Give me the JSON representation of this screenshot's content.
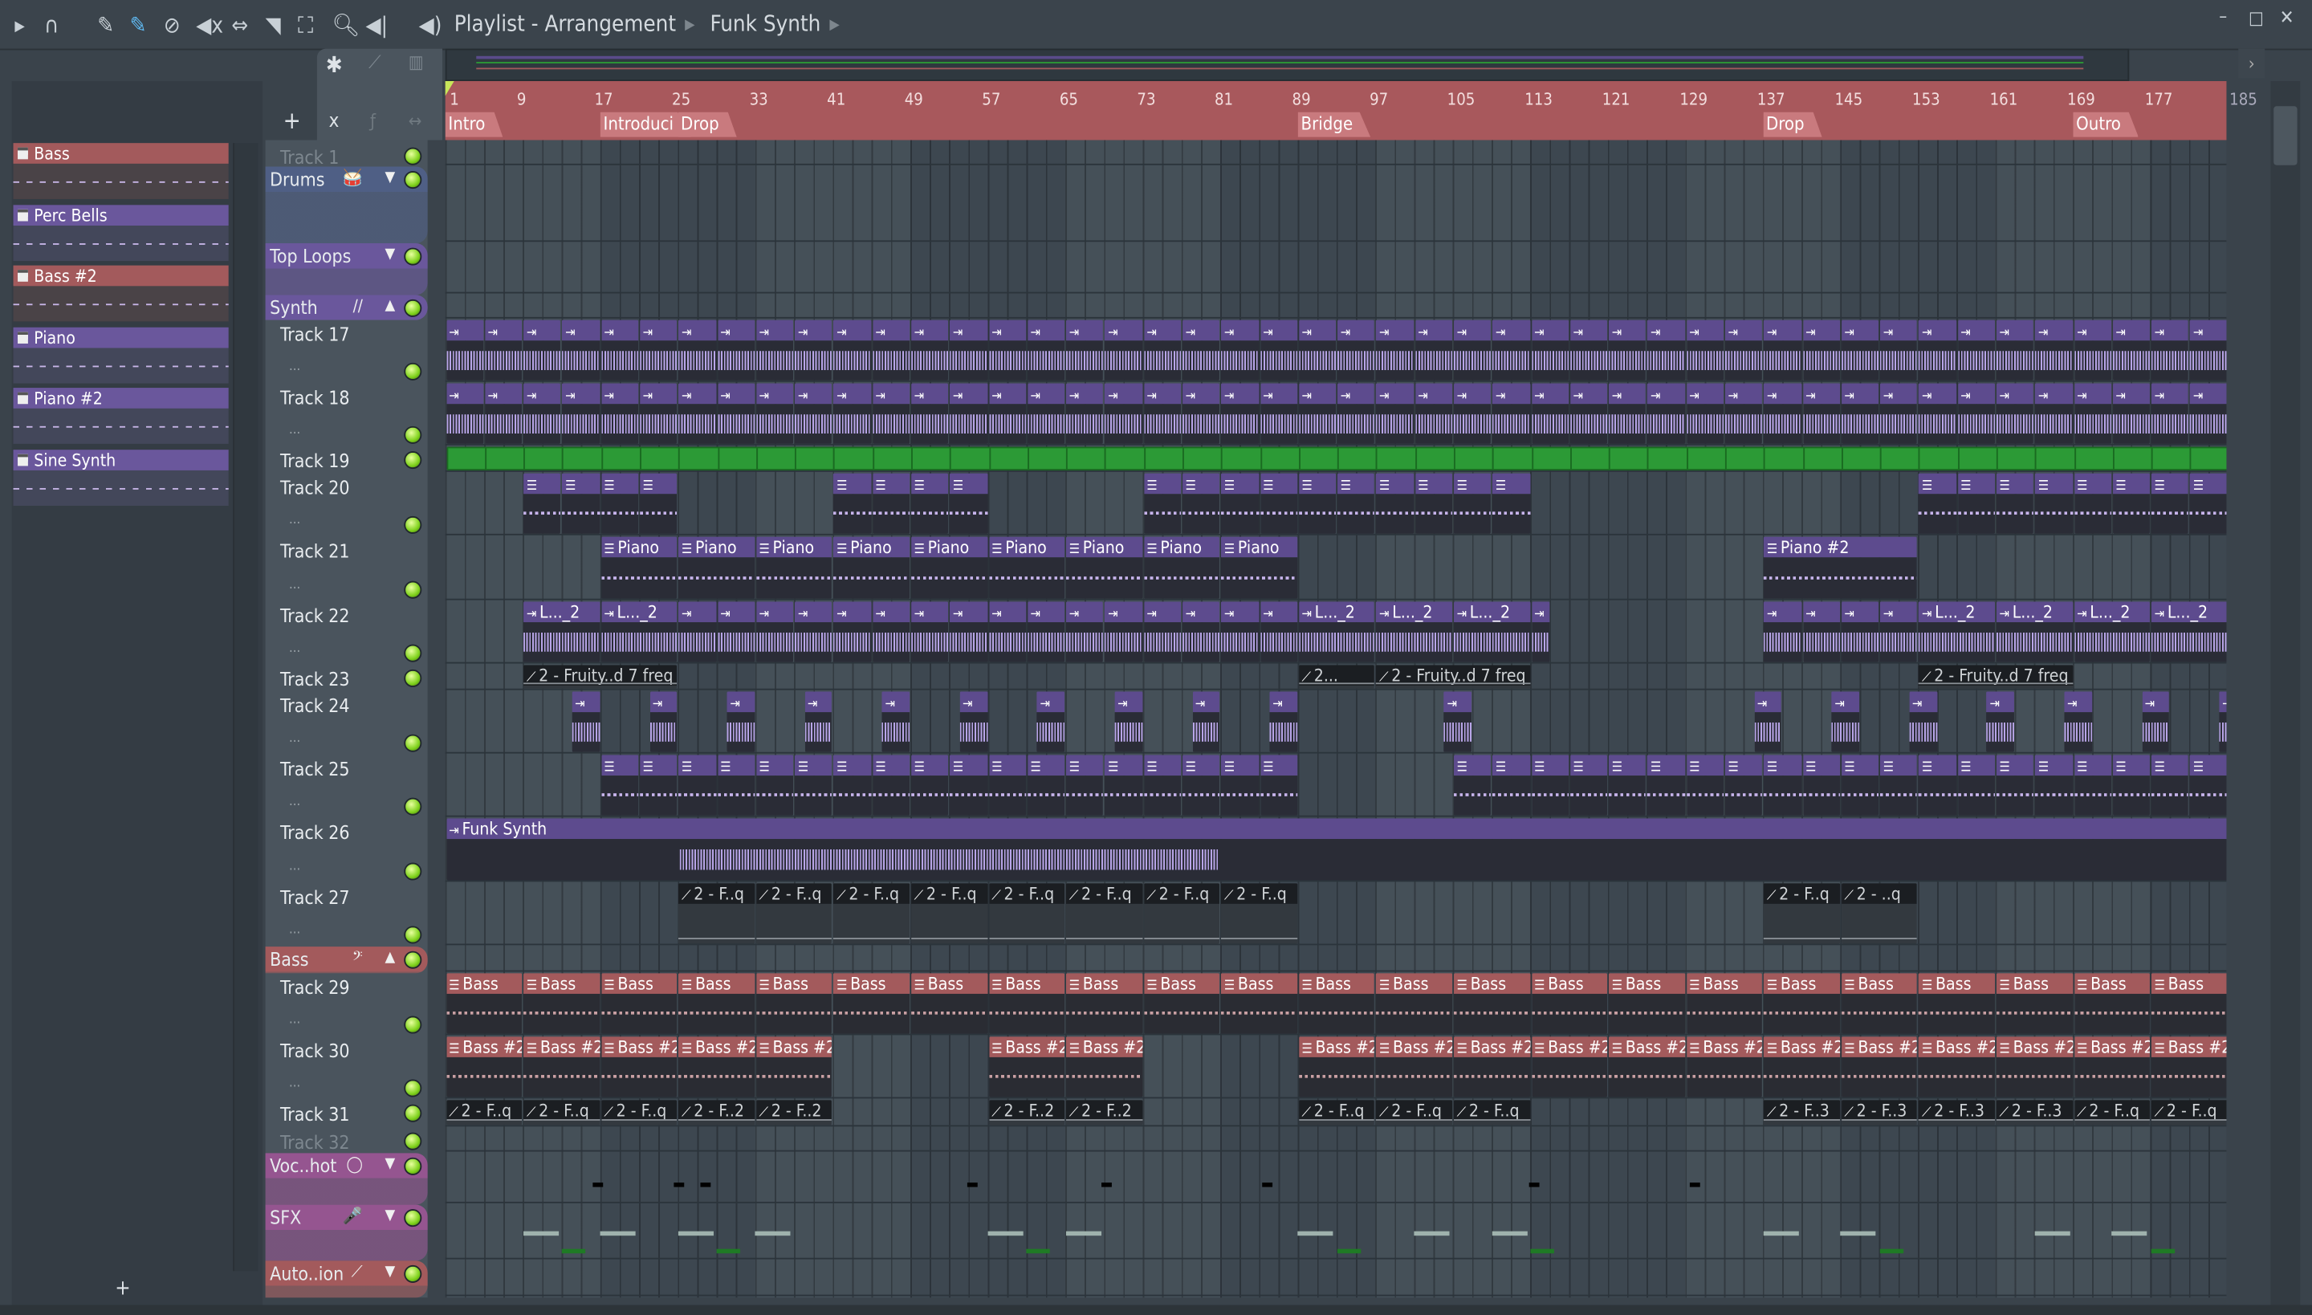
{
  "toolbar": {
    "icons": [
      "play-arrow-icon",
      "magnet-icon",
      "pencil-icon",
      "paint-brush-icon",
      "delete-icon",
      "mute-icon",
      "slip-icon",
      "slice-icon",
      "select-icon",
      "zoom-icon",
      "playback-icon"
    ],
    "breadcrumb": [
      "Playlist - Arrangement",
      "Funk Synth"
    ]
  },
  "browser": {
    "patterns": [
      {
        "name": "Bass",
        "color": "#a35a5c"
      },
      {
        "name": "Perc Bells",
        "color": "#6a579c"
      },
      {
        "name": "Bass #2",
        "color": "#a35a5c"
      },
      {
        "name": "Piano",
        "color": "#6a579c"
      },
      {
        "name": "Piano #2",
        "color": "#6a579c"
      },
      {
        "name": "Sine Synth",
        "color": "#6a579c"
      }
    ],
    "add_label": "+"
  },
  "tracks": [
    {
      "label": "Track 1",
      "kind": "track",
      "dim": true
    },
    {
      "label": "Drums",
      "kind": "group",
      "color": "#4f5f85",
      "icon": "drum-icon",
      "icon_glyph": "🥁",
      "arrow": "▼"
    },
    {
      "label": "Top Loops",
      "kind": "group",
      "color": "#6a579c",
      "arrow": "▼"
    },
    {
      "label": "Synth",
      "kind": "group",
      "color": "#6a579c",
      "icon": "waveform-icon",
      "icon_glyph": "∕∕",
      "arrow": "▲"
    },
    {
      "label": "Track 17",
      "kind": "track"
    },
    {
      "label": "Track 18",
      "kind": "track"
    },
    {
      "label": "Track 19",
      "kind": "track"
    },
    {
      "label": "Track 20",
      "kind": "track"
    },
    {
      "label": "Track 21",
      "kind": "track"
    },
    {
      "label": "Track 22",
      "kind": "track"
    },
    {
      "label": "Track 23",
      "kind": "track"
    },
    {
      "label": "Track 24",
      "kind": "track"
    },
    {
      "label": "Track 25",
      "kind": "track"
    },
    {
      "label": "Track 26",
      "kind": "track"
    },
    {
      "label": "Track 27",
      "kind": "track"
    },
    {
      "label": "Bass",
      "kind": "group",
      "color": "#a35a5c",
      "icon": "bass-clef-icon",
      "icon_glyph": "𝄢",
      "arrow": "▲"
    },
    {
      "label": "Track 29",
      "kind": "track"
    },
    {
      "label": "Track 30",
      "kind": "track"
    },
    {
      "label": "Track 31",
      "kind": "track"
    },
    {
      "label": "Track 32",
      "kind": "track",
      "dim": true
    },
    {
      "label": "Voc..hot",
      "kind": "group",
      "color": "#955590",
      "icon": "lips-icon",
      "icon_glyph": "◯",
      "arrow": "▼"
    },
    {
      "label": "SFX",
      "kind": "group",
      "color": "#955590",
      "icon": "microphone-icon",
      "icon_glyph": "🎤",
      "arrow": "▼"
    },
    {
      "label": "Auto..ion",
      "kind": "group",
      "color": "#a35a5c",
      "icon": "automation-icon",
      "icon_glyph": "⟋",
      "arrow": "▼"
    }
  ],
  "ruler": {
    "bars": [
      "1",
      "9",
      "17",
      "25",
      "33",
      "41",
      "49",
      "57",
      "65",
      "73",
      "81",
      "89",
      "97",
      "105",
      "113",
      "121",
      "129",
      "137",
      "145",
      "153",
      "161",
      "169",
      "177",
      "185"
    ],
    "markers": [
      {
        "label": "Intro",
        "bar": 1
      },
      {
        "label": "Introduci",
        "bar": 17
      },
      {
        "label": "Drop",
        "bar": 25
      },
      {
        "label": "Bridge",
        "bar": 89
      },
      {
        "label": "Drop",
        "bar": 137
      },
      {
        "label": "Outro",
        "bar": 169
      }
    ]
  },
  "clips": [
    {
      "track": 4,
      "from": 1,
      "to": 185,
      "len": 4,
      "kind": "audio",
      "label": ""
    },
    {
      "track": 5,
      "from": 1,
      "to": 185,
      "len": 4,
      "kind": "audio",
      "label": ""
    },
    {
      "track": 6,
      "from": 1,
      "to": 185,
      "len": 4,
      "kind": "green",
      "label": ""
    },
    {
      "track": 7,
      "from": 9,
      "to": 25,
      "len": 4,
      "kind": "pat",
      "label": ""
    },
    {
      "track": 7,
      "from": 41,
      "to": 57,
      "len": 4,
      "kind": "pat",
      "label": ""
    },
    {
      "track": 7,
      "from": 73,
      "to": 113,
      "len": 4,
      "kind": "pat",
      "label": ""
    },
    {
      "track": 7,
      "from": 153,
      "to": 185,
      "len": 4,
      "kind": "pat",
      "label": ""
    },
    {
      "track": 8,
      "from": 17,
      "to": 89,
      "len": 8,
      "kind": "pat",
      "label": "Piano"
    },
    {
      "track": 8,
      "from": 137,
      "to": 153,
      "len": 16,
      "kind": "pat",
      "label": "Piano #2"
    },
    {
      "track": 9,
      "from": 9,
      "to": 25,
      "len": 8,
      "kind": "audio",
      "label": "L..._2"
    },
    {
      "track": 9,
      "from": 25,
      "to": 89,
      "len": 4,
      "kind": "audio",
      "label": ""
    },
    {
      "track": 9,
      "from": 89,
      "to": 113,
      "len": 8,
      "kind": "audio",
      "label": "L..._2"
    },
    {
      "track": 9,
      "from": 113,
      "to": 115,
      "len": 2,
      "kind": "audio",
      "label": ""
    },
    {
      "track": 9,
      "from": 137,
      "to": 153,
      "len": 4,
      "kind": "audio",
      "label": ""
    },
    {
      "track": 9,
      "from": 153,
      "to": 185,
      "len": 8,
      "kind": "audio",
      "label": "L..._2"
    },
    {
      "track": 10,
      "from": 9,
      "to": 25,
      "len": 16,
      "kind": "auto",
      "label": "2 - Fruity..d 7 freq"
    },
    {
      "track": 10,
      "from": 89,
      "to": 97,
      "len": 8,
      "kind": "auto",
      "label": "2..."
    },
    {
      "track": 10,
      "from": 97,
      "to": 113,
      "len": 16,
      "kind": "auto",
      "label": "2 - Fruity..d 7 freq"
    },
    {
      "track": 10,
      "from": 153,
      "to": 169,
      "len": 16,
      "kind": "auto",
      "label": "2 - Fruity..d 7 freq"
    },
    {
      "track": 11,
      "from": 14,
      "to": 90,
      "len": 8,
      "kind": "audio",
      "label": "",
      "w": 3
    },
    {
      "track": 11,
      "from": 104,
      "to": 107,
      "len": 3,
      "kind": "audio",
      "label": ""
    },
    {
      "track": 11,
      "from": 136,
      "to": 185,
      "len": 8,
      "kind": "audio",
      "label": "",
      "w": 3
    },
    {
      "track": 12,
      "from": 17,
      "to": 89,
      "len": 4,
      "kind": "pat",
      "label": ""
    },
    {
      "track": 12,
      "from": 105,
      "to": 185,
      "len": 4,
      "kind": "pat",
      "label": ""
    },
    {
      "track": 13,
      "from": 1,
      "to": 185,
      "len": 184,
      "kind": "audio",
      "label": "Funk Synth"
    },
    {
      "track": 14,
      "from": 25,
      "to": 89,
      "len": 8,
      "kind": "auto",
      "label": "2 - F..q"
    },
    {
      "track": 14,
      "from": 137,
      "to": 145,
      "len": 8,
      "kind": "auto",
      "label": "2 - F..q"
    },
    {
      "track": 14,
      "from": 145,
      "to": 153,
      "len": 8,
      "kind": "auto",
      "label": "2 - ..q"
    },
    {
      "track": 16,
      "from": 1,
      "to": 185,
      "len": 8,
      "kind": "bass",
      "label": "Bass"
    },
    {
      "track": 17,
      "from": 1,
      "to": 41,
      "len": 8,
      "kind": "bass",
      "label": "Bass #2"
    },
    {
      "track": 17,
      "from": 57,
      "to": 73,
      "len": 8,
      "kind": "bass",
      "label": "Bass #2"
    },
    {
      "track": 17,
      "from": 89,
      "to": 185,
      "len": 8,
      "kind": "bass",
      "label": "Bass #2"
    },
    {
      "track": 18,
      "from": 1,
      "to": 25,
      "len": 8,
      "kind": "auto",
      "label": "2 - F..q"
    },
    {
      "track": 18,
      "from": 25,
      "to": 41,
      "len": 8,
      "kind": "auto",
      "label": "2 - F..2"
    },
    {
      "track": 18,
      "from": 57,
      "to": 73,
      "len": 8,
      "kind": "auto",
      "label": "2 - F..2"
    },
    {
      "track": 18,
      "from": 89,
      "to": 113,
      "len": 8,
      "kind": "auto",
      "label": "2 - F..q"
    },
    {
      "track": 18,
      "from": 137,
      "to": 169,
      "len": 8,
      "kind": "auto",
      "label": "2 - F..3"
    },
    {
      "track": 18,
      "from": 169,
      "to": 185,
      "len": 8,
      "kind": "auto",
      "label": "2 - F..q"
    }
  ]
}
